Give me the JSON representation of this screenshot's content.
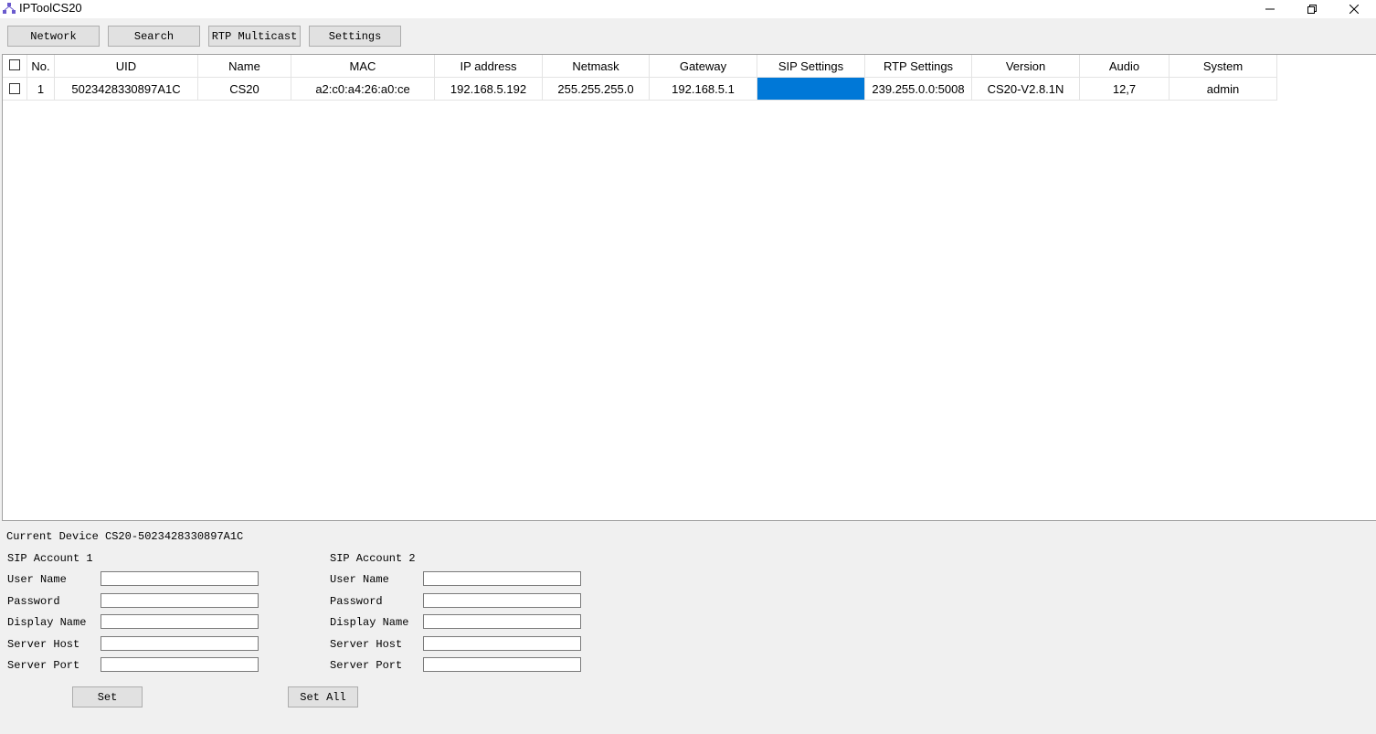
{
  "window": {
    "title": "IPToolCS20",
    "icon": "network-app-icon",
    "controls": {
      "minimize": "minimize-icon",
      "restore": "restore-icon",
      "close": "close-icon"
    }
  },
  "toolbar": {
    "buttons": [
      "Network",
      "Search",
      "RTP Multicast",
      "Settings"
    ]
  },
  "table": {
    "columns": [
      "No.",
      "UID",
      "Name",
      "MAC",
      "IP address",
      "Netmask",
      "Gateway",
      "SIP Settings",
      "RTP Settings",
      "Version",
      "Audio",
      "System"
    ],
    "rows": [
      {
        "checked": false,
        "no": "1",
        "uid": "5023428330897A1C",
        "name": "CS20",
        "mac": "a2:c0:a4:26:a0:ce",
        "ip": "192.168.5.192",
        "netmask": "255.255.255.0",
        "gateway": "192.168.5.1",
        "sip_settings": "",
        "rtp_settings": "239.255.0.0:5008",
        "version": "CS20-V2.8.1N",
        "audio": "12,7",
        "system": "admin"
      }
    ],
    "selected_cell": "sip_settings",
    "selection_color": "#0078d7"
  },
  "panel": {
    "current_device": "Current Device CS20-5023428330897A1C",
    "account1": {
      "title": "SIP Account 1",
      "fields": [
        "User Name",
        "Password",
        "Display Name",
        "Server Host",
        "Server Port"
      ],
      "values": [
        "",
        "",
        "",
        "",
        ""
      ]
    },
    "account2": {
      "title": "SIP Account 2",
      "fields": [
        "User Name",
        "Password",
        "Display Name",
        "Server Host",
        "Server Port"
      ],
      "values": [
        "",
        "",
        "",
        "",
        ""
      ]
    },
    "set_label": "Set",
    "set_all_label": "Set All"
  }
}
